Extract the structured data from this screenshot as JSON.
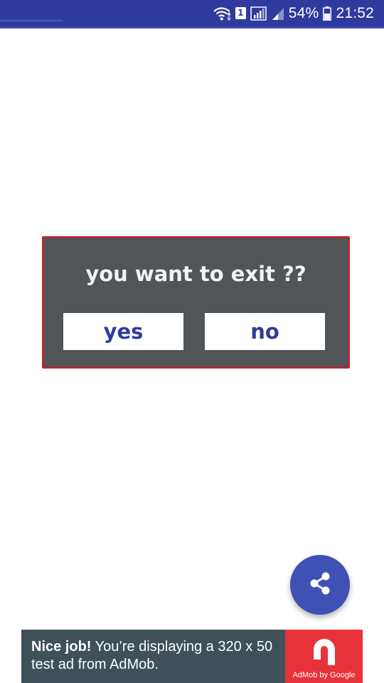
{
  "status_bar": {
    "sim_slot": "1",
    "battery_percent": "54%",
    "time": "21:52",
    "icons": [
      "wifi-icon",
      "sim-badge-icon",
      "signal-icon",
      "signal-weak-icon",
      "battery-icon"
    ]
  },
  "dialog": {
    "title": "you want to exit ??",
    "yes_label": "yes",
    "no_label": "no",
    "colors": {
      "background": "#525557",
      "border": "#e0151c",
      "button_text": "#303c9b"
    }
  },
  "fab": {
    "icon": "share-icon",
    "color": "#3f51b5"
  },
  "ad": {
    "headline": "Nice job!",
    "message": " You’re displaying a 320 x 50 test ad from AdMob.",
    "logo_caption": "AdMob by Google",
    "colors": {
      "background": "#3f5059",
      "logo_background": "#e8323a"
    }
  },
  "theme": {
    "status_bar_color": "#2f3a9e",
    "accent": "#3f51b5"
  }
}
